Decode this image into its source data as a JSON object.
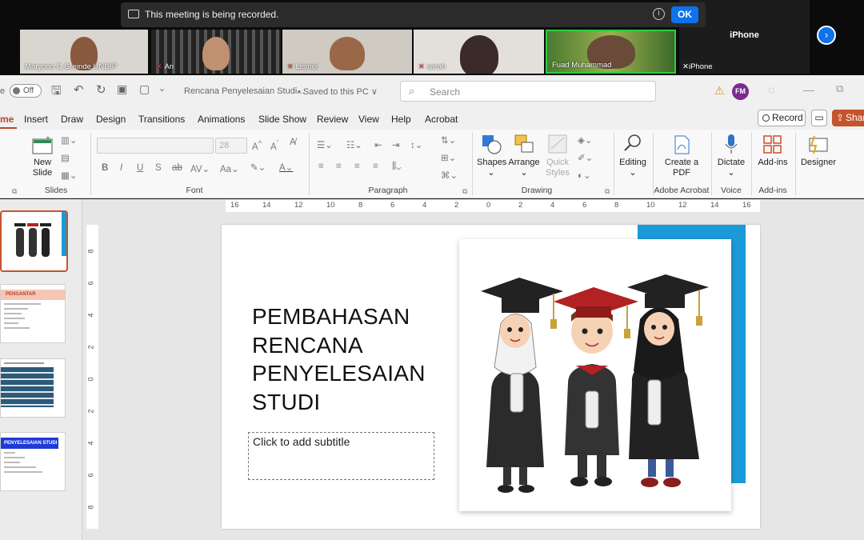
{
  "meeting": {
    "banner": "This meeting is being recorded.",
    "ok": "OK",
    "participants": [
      "Maryono C.Greinde.UNDIP",
      "Ari",
      "Lismei",
      "sarah",
      "Fuad Muhammad",
      "iPhone"
    ],
    "big_tile": "iPhone"
  },
  "titlebar": {
    "autosave": "Off",
    "doc": "Rencana Penyelesaian Studi...",
    "saved": "• Saved to this PC ∨",
    "search": "Search",
    "avatar": "FM"
  },
  "tabs": [
    "me",
    "Insert",
    "Draw",
    "Design",
    "Transitions",
    "Animations",
    "Slide Show",
    "Review",
    "View",
    "Help",
    "Acrobat"
  ],
  "record": "Record",
  "share": "Shar",
  "ribbon": {
    "new_slide": "New Slide",
    "slides": "Slides",
    "font": "Font",
    "font_size": "28",
    "paragraph": "Paragraph",
    "shapes": "Shapes",
    "arrange": "Arrange",
    "quick": "Quick Styles",
    "drawing": "Drawing",
    "editing": "Editing",
    "create_pdf": "Create a PDF",
    "acrobat": "Adobe Acrobat",
    "dictate": "Dictate",
    "voice": "Voice",
    "addins": "Add-ins",
    "addins_grp": "Add-ins",
    "designer": "Designer"
  },
  "thumbs": [
    {
      "num": "",
      "title": ""
    },
    {
      "num": "",
      "title": "PENGANTAR"
    },
    {
      "num": "",
      "title": ""
    },
    {
      "num": "",
      "title": "PENYELESAIAN STUDI"
    }
  ],
  "ruler": [
    "16",
    "14",
    "12",
    "10",
    "8",
    "6",
    "4",
    "2",
    "0",
    "2",
    "4",
    "6",
    "8",
    "10",
    "12",
    "14",
    "16"
  ],
  "vruler": [
    "8",
    "6",
    "4",
    "2",
    "0",
    "2",
    "4",
    "6",
    "8"
  ],
  "slide": {
    "title": "PEMBAHASAN RENCANA PENYELESAIAN STUDI",
    "subtitle": "Click to add subtitle"
  },
  "colors": {
    "accent": "#b7472a",
    "blue": "#1a9ad6",
    "zoom": "#0e72ed"
  }
}
